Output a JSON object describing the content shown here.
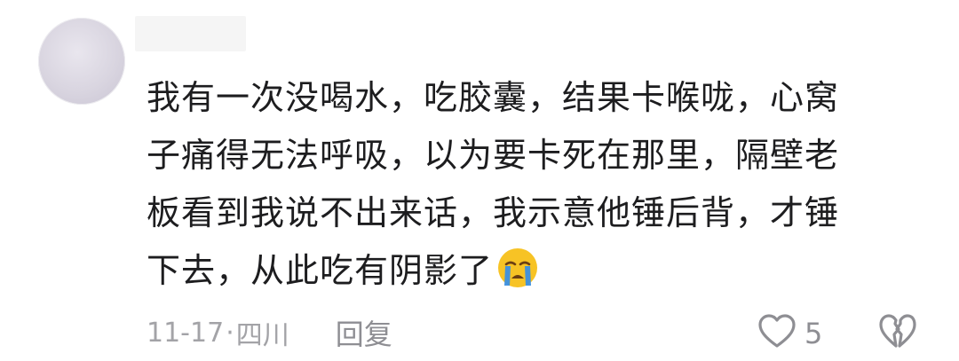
{
  "comment": {
    "body_lines": [
      "我有一次没喝水，吃胶囊，结果卡喉咙，心窝",
      "子痛得无法呼吸，以为要卡死在那里，隔壁老",
      "板看到我说不出来话，我示意他锤后背，才锤",
      "下去，从此吃有阴影了"
    ],
    "emoji": "loudly-crying-face",
    "meta": {
      "date": "11-17",
      "separator": "·",
      "location": "四川"
    },
    "reply_label": "回复",
    "like_count": "5"
  },
  "icons": {
    "like": "heart-outline-icon",
    "dislike": "broken-heart-outline-icon"
  },
  "colors": {
    "text": "#1d1d1f",
    "meta": "#a3a3a7",
    "action": "#8e8e93",
    "emoji_face": "#f7c325",
    "emoji_tears": "#3b8fe0"
  }
}
